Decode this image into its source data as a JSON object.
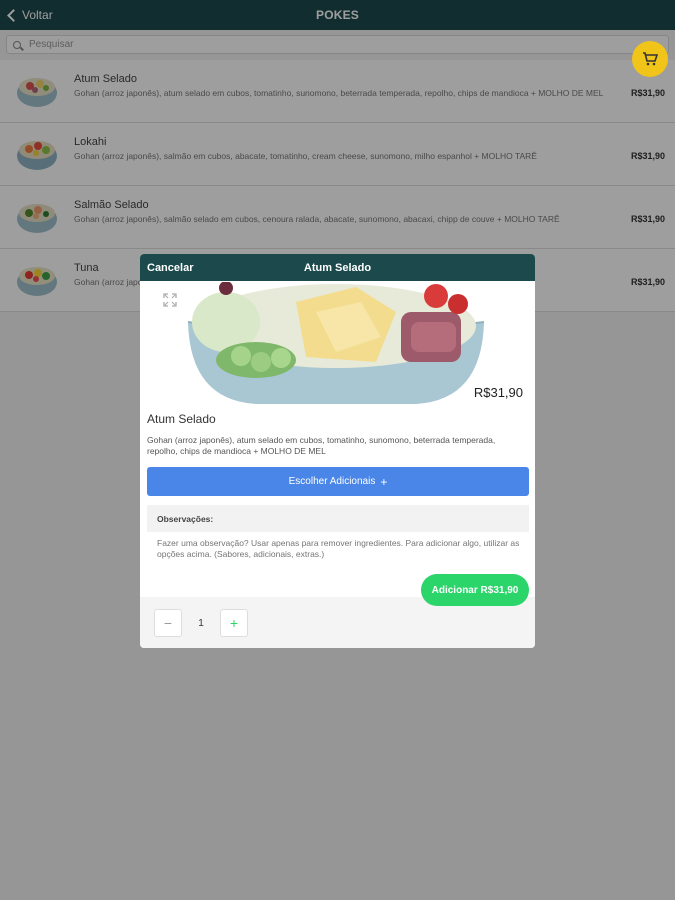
{
  "header": {
    "back_label": "Voltar",
    "title": "POKES"
  },
  "search": {
    "placeholder": "Pesquisar"
  },
  "cart": {
    "icon": "cart-icon",
    "color": "#f0c419"
  },
  "items": [
    {
      "name": "Atum Selado",
      "description": "Gohan (arroz japonês), atum selado em cubos, tomatinho, sunomono, beterrada temperada, repolho, chips de mandioca + MOLHO DE MEL",
      "price": "R$31,90"
    },
    {
      "name": "Lokahi",
      "description": "Gohan (arroz japonês), salmão em cubos, abacate, tomatinho, cream cheese, sunomono, milho espanhol + MOLHO TARÊ",
      "price": "R$31,90"
    },
    {
      "name": "Salmão Selado",
      "description": "Gohan (arroz japonês), salmão selado em cubos, cenoura ralada, abacate, sunomono, abacaxi, chipp de couve + MOLHO TARÊ",
      "price": "R$31,90"
    },
    {
      "name": "Tuna",
      "description": "Gohan (arroz japonês), atum em cubos, ... + MOLHO TARÊ",
      "price": "R$31,90"
    }
  ],
  "modal": {
    "cancel_label": "Cancelar",
    "title": "Atum Selado",
    "price": "R$31,90",
    "name": "Atum Selado",
    "description": "Gohan (arroz japonês), atum selado em cubos, tomatinho, sunomono, beterrada temperada, repolho, chips de mandioca + MOLHO DE MEL",
    "choose_addons_label": "Escolher Adicionais",
    "observations_label": "Observações:",
    "observations_placeholder": "Fazer uma observação? Usar apenas para remover ingredientes. Para adicionar algo, utilizar as opções acima. (Sabores, adicionais, extras.)",
    "submit_label": "Adicionar  R$31,90",
    "quantity": "1"
  },
  "colors": {
    "header": "#1c4a4c",
    "addons_button": "#4a86e8",
    "submit_button": "#2bd56a"
  }
}
